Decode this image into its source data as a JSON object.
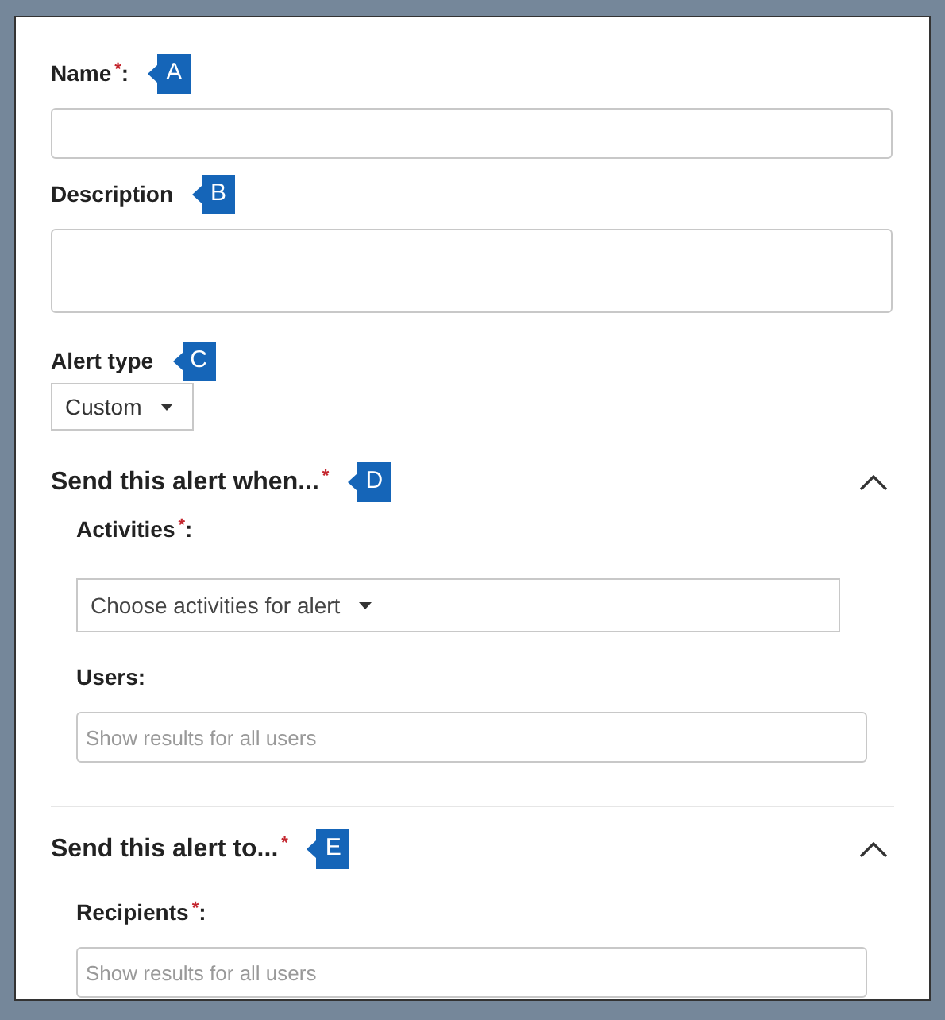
{
  "fields": [
    {
      "kind": "text",
      "label": "Name",
      "required_mark": "*",
      "suffix": ":",
      "callout": "A"
    },
    {
      "kind": "textarea",
      "label": "Description",
      "callout": "B"
    },
    {
      "kind": "select",
      "label": "Alert type",
      "value": "Custom",
      "callout": "C"
    }
  ],
  "sections": [
    {
      "title": "Send this alert when...",
      "required_mark": "*",
      "callout": "D",
      "expanded": true,
      "fields": [
        {
          "kind": "dropdown",
          "label": "Activities",
          "required_mark": "*",
          "suffix": ":",
          "value": "Choose activities for alert"
        },
        {
          "kind": "text",
          "label": "Users:",
          "placeholder": "Show results for all users"
        }
      ]
    },
    {
      "title": "Send this alert to...",
      "required_mark": "*",
      "callout": "E",
      "expanded": true,
      "fields": [
        {
          "kind": "text",
          "label": "Recipients",
          "required_mark": "*",
          "suffix": ":",
          "placeholder": "Show results for all users"
        }
      ]
    }
  ]
}
